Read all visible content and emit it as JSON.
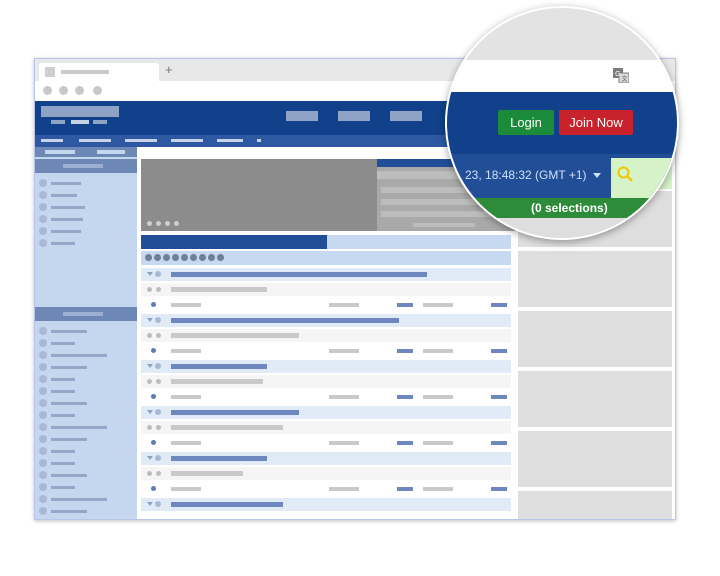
{
  "header": {
    "login_label": "Login",
    "join_label": "Join Now",
    "datetime": "23, 18:48:32 (GMT +1)"
  },
  "betslip": {
    "selections": "(0 selections)"
  },
  "browser": {
    "new_tab_symbol": "+",
    "close_symbol": "×"
  },
  "colors": {
    "header_blue": "#10418a",
    "login_green": "#1b8a3a",
    "join_red": "#c8232c",
    "betslip_green": "#2e8b3a",
    "search_yellow": "#f2c500"
  },
  "icons": {
    "translate": "translate-icon",
    "search": "search-icon",
    "dropdown": "chevron-down-icon"
  }
}
